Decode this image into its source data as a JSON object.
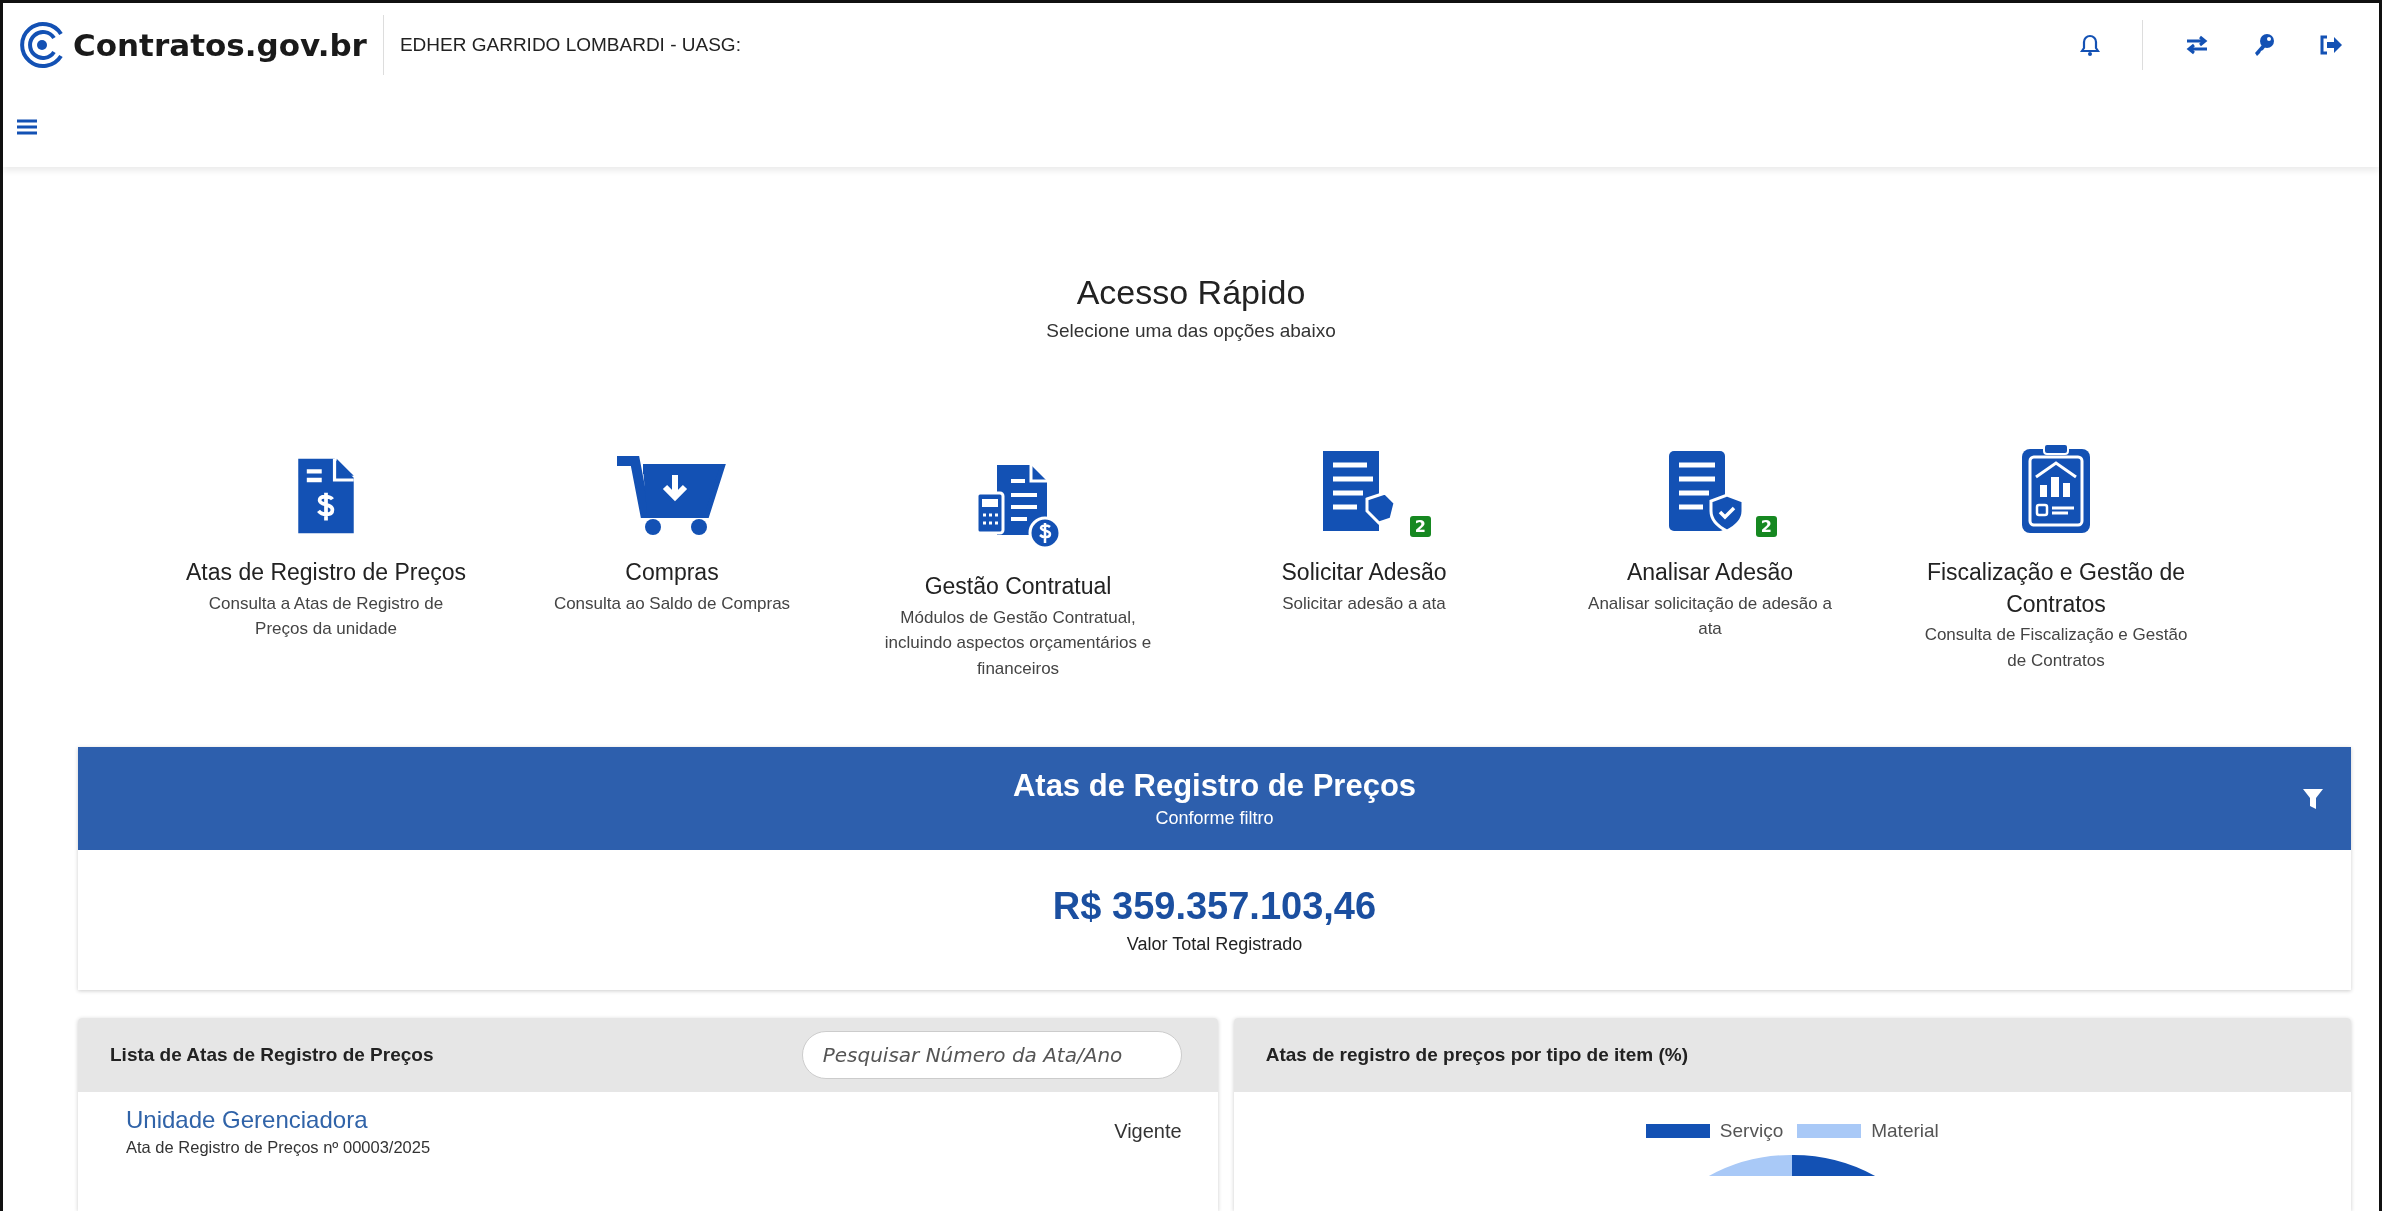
{
  "header": {
    "logo_text": "Contratos.gov.br",
    "user": "EDHER GARRIDO LOMBARDI - UASG:"
  },
  "quick_access": {
    "title": "Acesso Rápido",
    "subtitle": "Selecione uma das opções abaixo",
    "items": [
      {
        "kind": "price-doc",
        "title": "Atas de Registro de Preços",
        "description": "Consulta a Atas de Registro de Preços da unidade"
      },
      {
        "kind": "cart",
        "title": "Compras",
        "description": "Consulta ao Saldo de Compras"
      },
      {
        "kind": "contract-doc",
        "title": "Gestão Contratual",
        "description": "Módulos de Gestão Contratual, incluindo aspectos orçamentários e financeiros"
      },
      {
        "kind": "request-doc",
        "title": "Solicitar Adesão",
        "description": "Solicitar adesão a ata",
        "badge": "2"
      },
      {
        "kind": "shield-doc",
        "title": "Analisar Adesão",
        "description": "Analisar solicitação de adesão a ata",
        "badge": "2"
      },
      {
        "kind": "clipboard",
        "title": "Fiscalização e Gestão de Contratos",
        "description": "Consulta de Fiscalização e Gestão de Contratos"
      }
    ]
  },
  "summary": {
    "title": "Atas de Registro de Preços",
    "subtitle": "Conforme filtro",
    "value": "R$ 359.357.103,46",
    "value_label": "Valor Total Registrado"
  },
  "list": {
    "title": "Lista de Atas de Registro de Preços",
    "search": {
      "placeholder": "Pesquisar Número da Ata/Ano"
    },
    "rows": [
      {
        "title": "Unidade Gerenciadora",
        "subtitle": "Ata de Registro de Preços nº 00003/2025",
        "status": "Vigente"
      }
    ]
  },
  "chart_panel": {
    "title": "Atas de registro de preços por tipo de item (%)",
    "legend": [
      {
        "label": "Serviço",
        "color": "#1351b4"
      },
      {
        "label": "Material",
        "color": "#a9c9f7"
      }
    ]
  }
}
